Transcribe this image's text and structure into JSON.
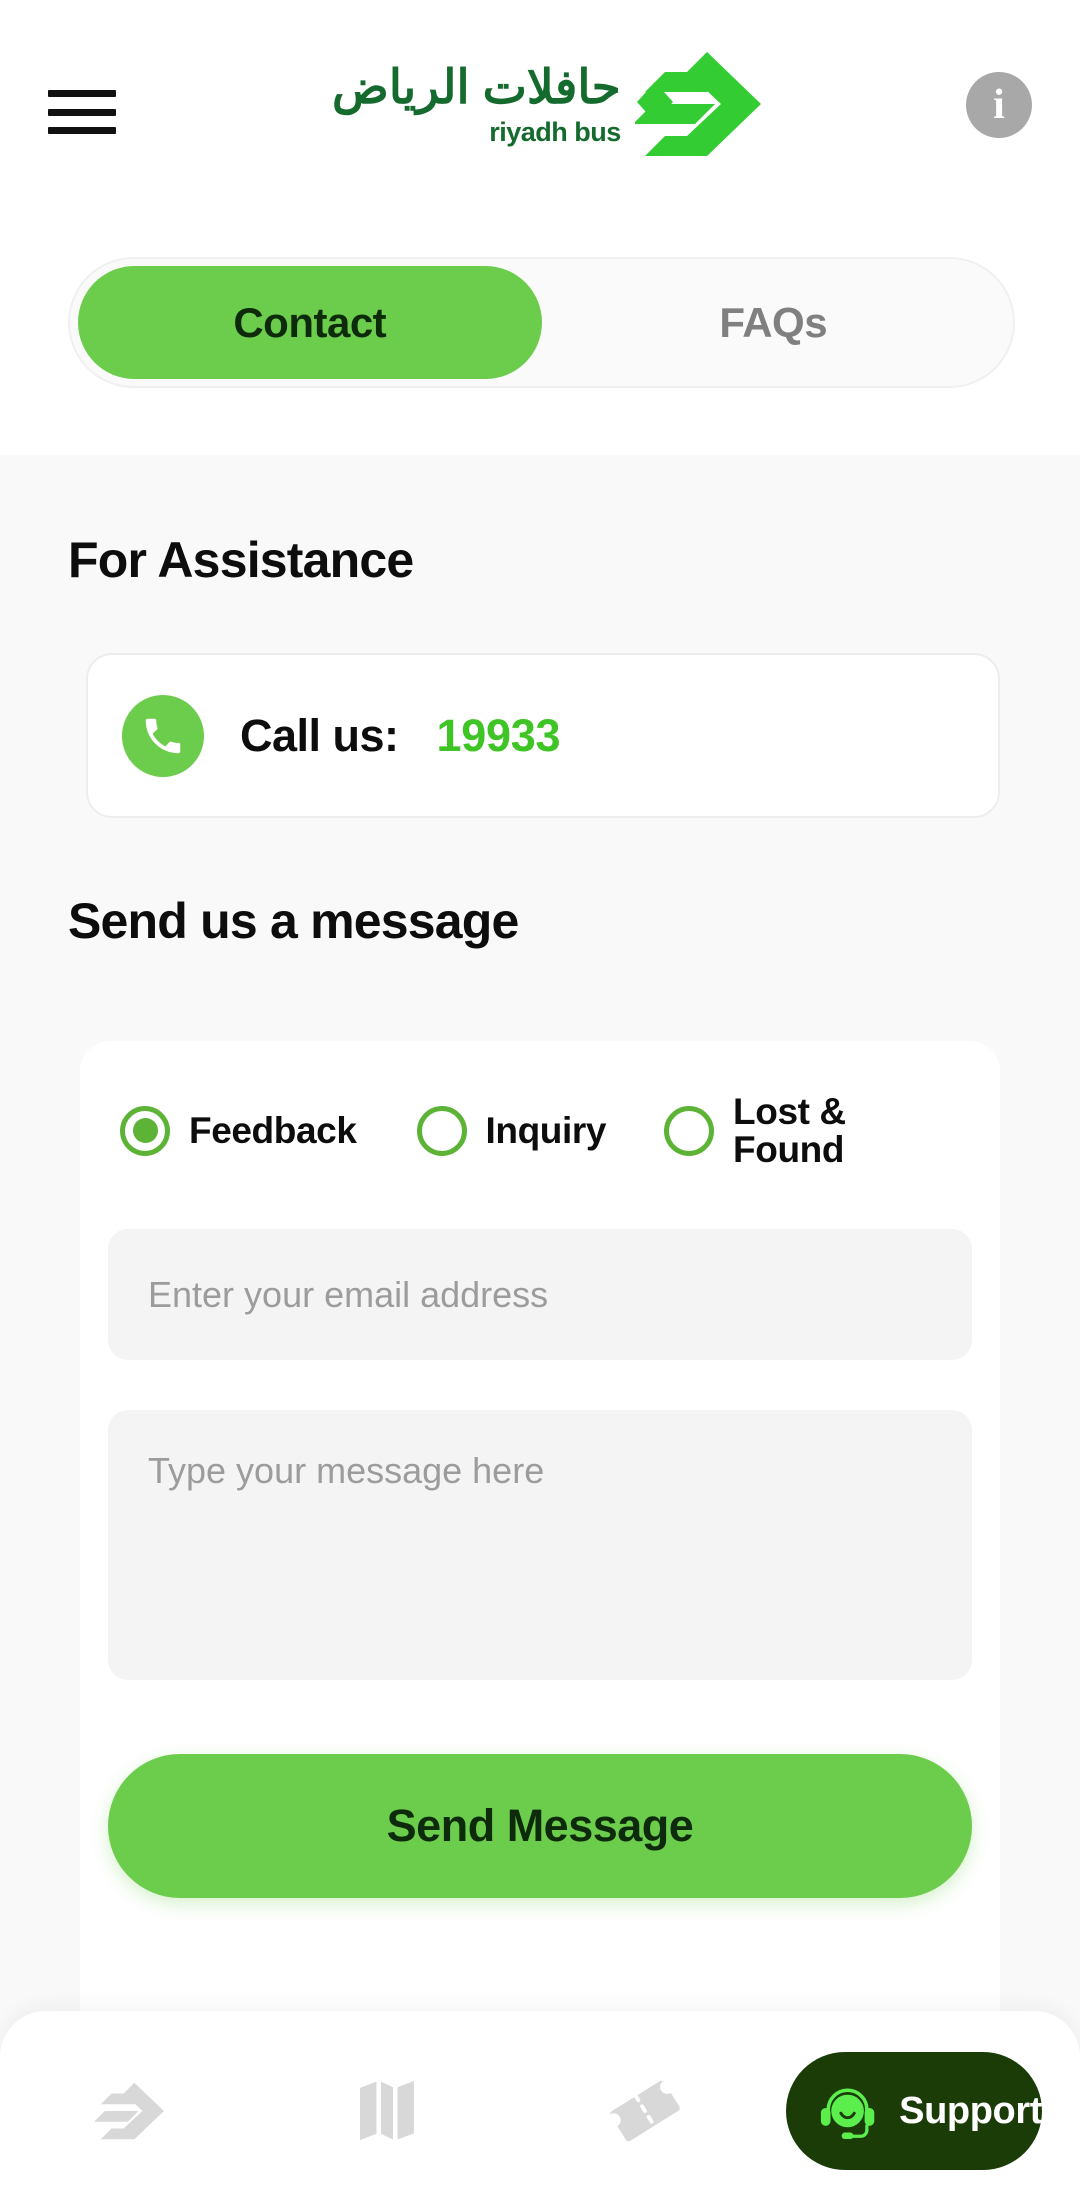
{
  "header": {
    "menu_icon": "hamburger-menu-icon",
    "brand_arabic": "حافلات الرياض",
    "brand_english": "riyadh bus",
    "brand_logo_icon": "riyadh-bus-arrows-logo",
    "info_icon_label": "i"
  },
  "tabs": [
    {
      "label": "Contact",
      "active": true
    },
    {
      "label": "FAQs",
      "active": false
    }
  ],
  "assistance": {
    "title": "For Assistance",
    "phone_icon": "phone-icon",
    "call_label": "Call us:",
    "call_number": "19933"
  },
  "message_form": {
    "title": "Send us a message",
    "options": [
      {
        "label": "Feedback",
        "selected": true
      },
      {
        "label": "Inquiry",
        "selected": false
      },
      {
        "label": "Lost & Found",
        "selected": false
      }
    ],
    "email_placeholder": "Enter your email address",
    "email_value": "",
    "message_placeholder": "Type your message here",
    "message_value": "",
    "submit_label": "Send Message"
  },
  "bottom_nav": {
    "items": [
      {
        "icon": "riyadh-bus-logo-icon"
      },
      {
        "icon": "map-icon"
      },
      {
        "icon": "ticket-icon"
      }
    ],
    "support": {
      "label": "Support",
      "icon": "headset-agent-icon"
    }
  },
  "colors": {
    "brand_green": "#6ccc4c",
    "accent_green": "#3ec424",
    "dark_green": "#1b3c07",
    "logo_green": "#156a2e",
    "page_bg": "#f9f9f9",
    "field_bg": "#f4f4f4",
    "muted_text": "#808080",
    "nav_icon_gray": "#d8d8d8"
  }
}
